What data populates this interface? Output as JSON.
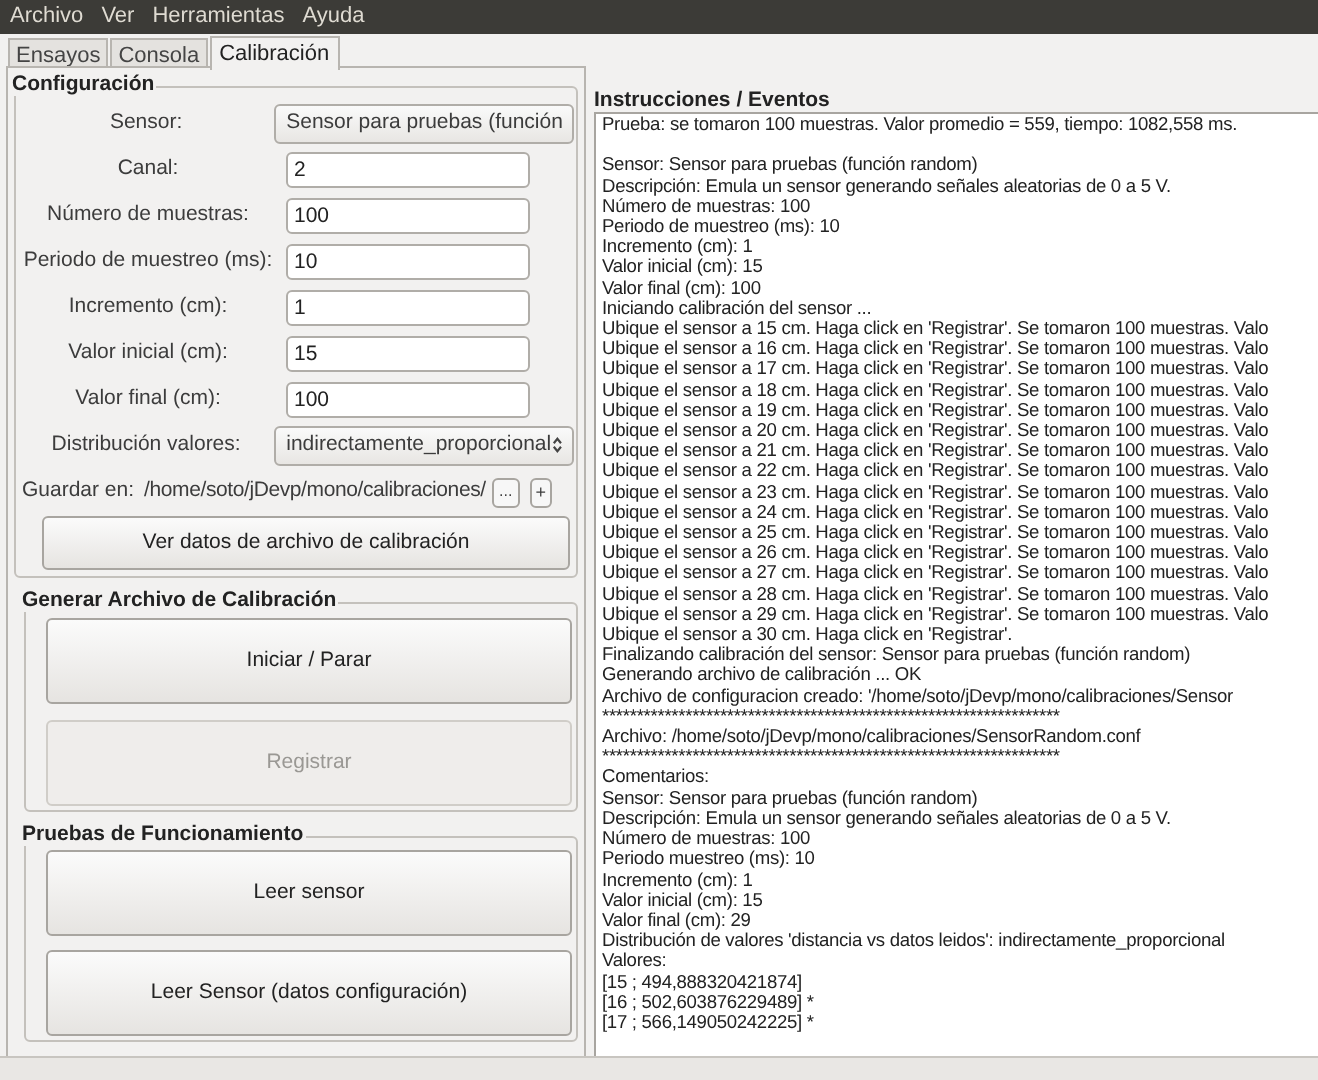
{
  "menu": [
    "Archivo",
    "Ver",
    "Herramientas",
    "Ayuda"
  ],
  "tabs": [
    {
      "label": "Ensayos",
      "selected": false
    },
    {
      "label": "Consola",
      "selected": false
    },
    {
      "label": "Calibración",
      "selected": true
    }
  ],
  "configuracion": {
    "title": "Configuración",
    "fields": [
      {
        "label": "Sensor:",
        "kind": "combo",
        "value": "Sensor para pruebas (función"
      },
      {
        "label": "Canal:",
        "kind": "text",
        "value": "2"
      },
      {
        "label": "Número de muestras:",
        "kind": "text",
        "value": "100"
      },
      {
        "label": "Periodo de muestreo (ms):",
        "kind": "text",
        "value": "10"
      },
      {
        "label": "Incremento (cm):",
        "kind": "text",
        "value": "1"
      },
      {
        "label": "Valor inicial (cm):",
        "kind": "text",
        "value": "15"
      },
      {
        "label": "Valor final (cm):",
        "kind": "text",
        "value": "100"
      },
      {
        "label": "Distribución valores:",
        "kind": "combo",
        "value": "indirectamente_proporcional"
      }
    ],
    "save": {
      "label": "Guardar en:",
      "path": "/home/soto/jDevp/mono/calibraciones/",
      "browse": "...",
      "add": "+"
    },
    "button": {
      "label": "Ver datos de archivo de calibración",
      "disabled": false
    }
  },
  "generar": {
    "title": "Generar Archivo de Calibración",
    "buttons": [
      {
        "label": "Iniciar / Parar",
        "disabled": false
      },
      {
        "label": "Registrar",
        "disabled": true
      }
    ]
  },
  "pruebas": {
    "title": "Pruebas de Funcionamiento",
    "buttons": [
      {
        "label": "Leer sensor",
        "disabled": false
      },
      {
        "label": "Leer Sensor (datos configuración)",
        "disabled": false
      }
    ]
  },
  "log": {
    "title": "Instrucciones / Eventos",
    "blocks": [
      [
        "Prueba: se tomaron 100 muestras. Valor promedio = 559, tiempo: 1082,558 ms."
      ],
      [
        "Sensor: Sensor para pruebas (función random)",
        "Descripción: Emula un sensor generando señales aleatorias de 0 a 5 V.",
        "Número de muestras: 100",
        "Periodo de muestreo (ms): 10",
        "Incremento (cm): 1",
        "Valor inicial (cm): 15",
        "Valor final (cm): 100",
        "Iniciando calibración del sensor ...",
        "Ubique el sensor a 15 cm. Haga click en 'Registrar'. Se tomaron 100 muestras. Valo",
        "Ubique el sensor a 16 cm. Haga click en 'Registrar'. Se tomaron 100 muestras. Valo",
        "Ubique el sensor a 17 cm. Haga click en 'Registrar'. Se tomaron 100 muestras. Valo",
        "Ubique el sensor a 18 cm. Haga click en 'Registrar'. Se tomaron 100 muestras. Valo",
        "Ubique el sensor a 19 cm. Haga click en 'Registrar'. Se tomaron 100 muestras. Valo",
        "Ubique el sensor a 20 cm. Haga click en 'Registrar'. Se tomaron 100 muestras. Valo",
        "Ubique el sensor a 21 cm. Haga click en 'Registrar'. Se tomaron 100 muestras. Valo",
        "Ubique el sensor a 22 cm. Haga click en 'Registrar'. Se tomaron 100 muestras. Valo",
        "Ubique el sensor a 23 cm. Haga click en 'Registrar'. Se tomaron 100 muestras. Valo",
        "Ubique el sensor a 24 cm. Haga click en 'Registrar'. Se tomaron 100 muestras. Valo",
        "Ubique el sensor a 25 cm. Haga click en 'Registrar'. Se tomaron 100 muestras. Valo",
        "Ubique el sensor a 26 cm. Haga click en 'Registrar'. Se tomaron 100 muestras. Valo",
        "Ubique el sensor a 27 cm. Haga click en 'Registrar'. Se tomaron 100 muestras. Valo",
        "Ubique el sensor a 28 cm. Haga click en 'Registrar'. Se tomaron 100 muestras. Valo",
        "Ubique el sensor a 29 cm. Haga click en 'Registrar'. Se tomaron 100 muestras. Valo",
        "Ubique el sensor a 30 cm. Haga click en 'Registrar'.",
        "Finalizando calibración del sensor: Sensor para pruebas (función random)",
        "Generando archivo de calibración ... OK",
        "Archivo de configuracion creado: '/home/soto/jDevp/mono/calibraciones/Sensor",
        "******************************************************************",
        "Archivo: /home/soto/jDevp/mono/calibraciones/SensorRandom.conf",
        "******************************************************************",
        "Comentarios:",
        "Sensor: Sensor para pruebas (función random)",
        "Descripción: Emula un sensor generando señales aleatorias de 0 a 5 V.",
        "Número de muestras: 100",
        "Periodo muestreo (ms): 10",
        "Incremento (cm): 1",
        "Valor inicial (cm): 15",
        "Valor final (cm): 29",
        "Distribución de valores 'distancia vs datos leidos': indirectamente_proporcional",
        "Valores:",
        "[15 ; 494,888320421874]",
        "[16 ; 502,603876229489] *",
        "[17 ; 566,149050242225] *"
      ]
    ]
  }
}
